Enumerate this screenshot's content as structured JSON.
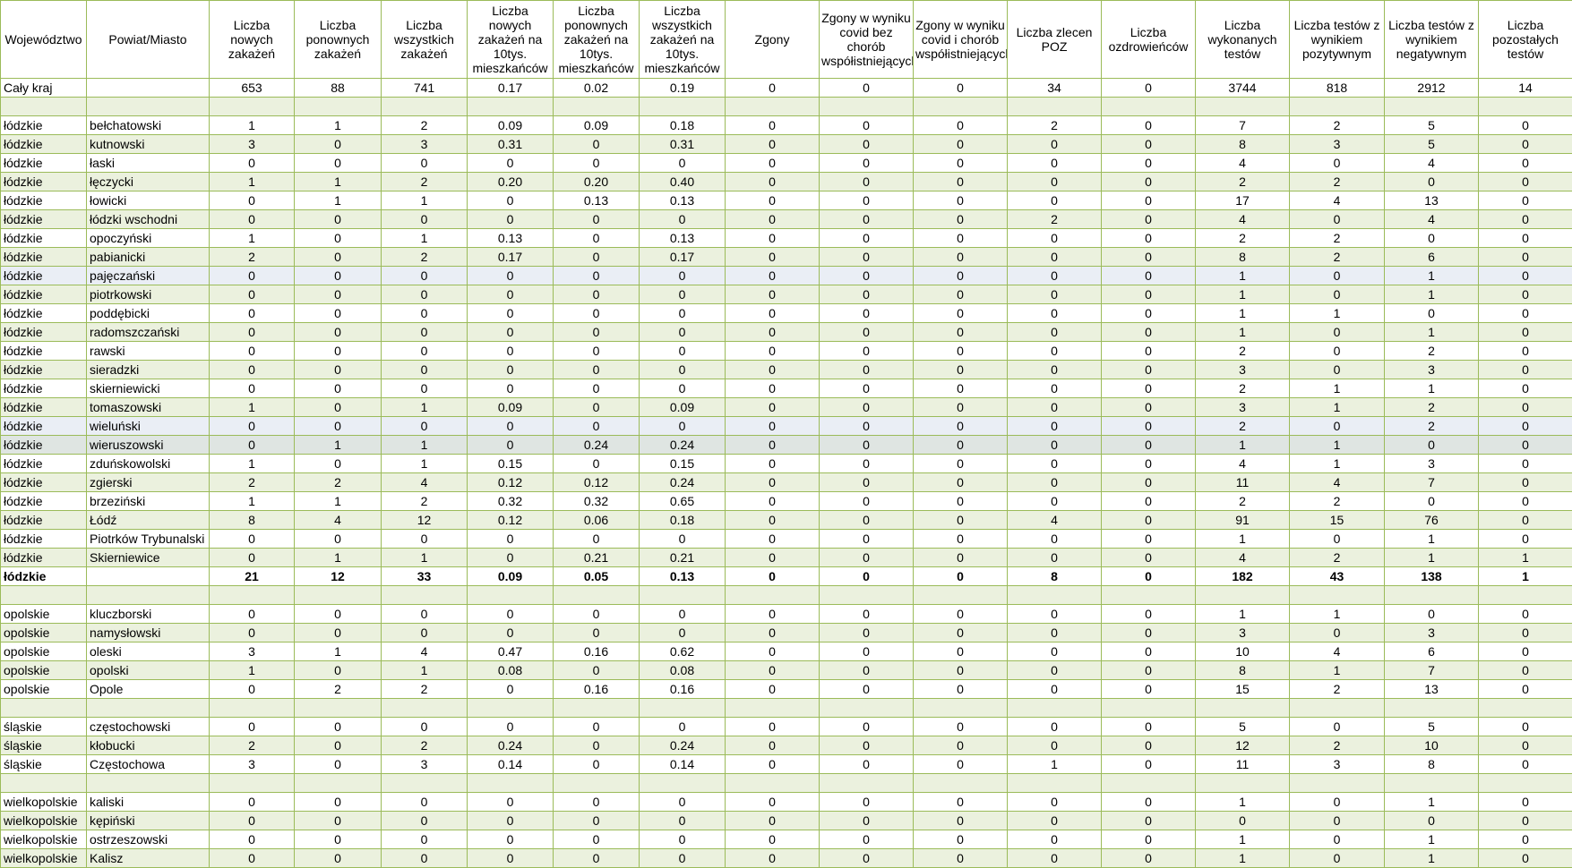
{
  "headers": [
    "Województwo",
    "Powiat/Miasto",
    "Liczba nowych zakażeń",
    "Liczba ponownych zakażeń",
    "Liczba wszystkich zakażeń",
    "Liczba nowych zakażeń na 10tys. mieszkańców",
    "Liczba ponownych zakażeń na 10tys. mieszkańców",
    "Liczba wszystkich zakażeń na 10tys. mieszkańców",
    "Zgony",
    "Zgony w wyniku covid bez chorób współistniejących",
    "Zgony w wyniku covid i chorób współistniejących",
    "Liczba zlecen POZ",
    "Liczba ozdrowieńców",
    "Liczba wykonanych testów",
    "Liczba testów z wynikiem pozytywnym",
    "Liczba testów z wynikiem negatywnym",
    "Liczba pozostałych testów"
  ],
  "rows": [
    {
      "cells": [
        "Cały kraj",
        "",
        "653",
        "88",
        "741",
        "0.17",
        "0.02",
        "0.19",
        "0",
        "0",
        "0",
        "34",
        "0",
        "3744",
        "818",
        "2912",
        "14"
      ]
    },
    {
      "cells": [
        "",
        "",
        "",
        "",
        "",
        "",
        "",
        "",
        "",
        "",
        "",
        "",
        "",
        "",
        "",
        "",
        ""
      ],
      "style": "g"
    },
    {
      "cells": [
        "łódzkie",
        "bełchatowski",
        "1",
        "1",
        "2",
        "0.09",
        "0.09",
        "0.18",
        "0",
        "0",
        "0",
        "2",
        "0",
        "7",
        "2",
        "5",
        "0"
      ]
    },
    {
      "cells": [
        "łódzkie",
        "kutnowski",
        "3",
        "0",
        "3",
        "0.31",
        "0",
        "0.31",
        "0",
        "0",
        "0",
        "0",
        "0",
        "8",
        "3",
        "5",
        "0"
      ],
      "style": "g"
    },
    {
      "cells": [
        "łódzkie",
        "łaski",
        "0",
        "0",
        "0",
        "0",
        "0",
        "0",
        "0",
        "0",
        "0",
        "0",
        "0",
        "4",
        "0",
        "4",
        "0"
      ]
    },
    {
      "cells": [
        "łódzkie",
        "łęczycki",
        "1",
        "1",
        "2",
        "0.20",
        "0.20",
        "0.40",
        "0",
        "0",
        "0",
        "0",
        "0",
        "2",
        "2",
        "0",
        "0"
      ],
      "style": "g"
    },
    {
      "cells": [
        "łódzkie",
        "łowicki",
        "0",
        "1",
        "1",
        "0",
        "0.13",
        "0.13",
        "0",
        "0",
        "0",
        "0",
        "0",
        "17",
        "4",
        "13",
        "0"
      ]
    },
    {
      "cells": [
        "łódzkie",
        "łódzki wschodni",
        "0",
        "0",
        "0",
        "0",
        "0",
        "0",
        "0",
        "0",
        "0",
        "2",
        "0",
        "4",
        "0",
        "4",
        "0"
      ],
      "style": "g"
    },
    {
      "cells": [
        "łódzkie",
        "opoczyński",
        "1",
        "0",
        "1",
        "0.13",
        "0",
        "0.13",
        "0",
        "0",
        "0",
        "0",
        "0",
        "2",
        "2",
        "0",
        "0"
      ]
    },
    {
      "cells": [
        "łódzkie",
        "pabianicki",
        "2",
        "0",
        "2",
        "0.17",
        "0",
        "0.17",
        "0",
        "0",
        "0",
        "0",
        "0",
        "8",
        "2",
        "6",
        "0"
      ],
      "style": "g"
    },
    {
      "cells": [
        "łódzkie",
        "pajęczański",
        "0",
        "0",
        "0",
        "0",
        "0",
        "0",
        "0",
        "0",
        "0",
        "0",
        "0",
        "1",
        "0",
        "1",
        "0"
      ],
      "style": "b"
    },
    {
      "cells": [
        "łódzkie",
        "piotrkowski",
        "0",
        "0",
        "0",
        "0",
        "0",
        "0",
        "0",
        "0",
        "0",
        "0",
        "0",
        "1",
        "0",
        "1",
        "0"
      ],
      "style": "g"
    },
    {
      "cells": [
        "łódzkie",
        "poddębicki",
        "0",
        "0",
        "0",
        "0",
        "0",
        "0",
        "0",
        "0",
        "0",
        "0",
        "0",
        "1",
        "1",
        "0",
        "0"
      ]
    },
    {
      "cells": [
        "łódzkie",
        "radomszczański",
        "0",
        "0",
        "0",
        "0",
        "0",
        "0",
        "0",
        "0",
        "0",
        "0",
        "0",
        "1",
        "0",
        "1",
        "0"
      ],
      "style": "g"
    },
    {
      "cells": [
        "łódzkie",
        "rawski",
        "0",
        "0",
        "0",
        "0",
        "0",
        "0",
        "0",
        "0",
        "0",
        "0",
        "0",
        "2",
        "0",
        "2",
        "0"
      ]
    },
    {
      "cells": [
        "łódzkie",
        "sieradzki",
        "0",
        "0",
        "0",
        "0",
        "0",
        "0",
        "0",
        "0",
        "0",
        "0",
        "0",
        "3",
        "0",
        "3",
        "0"
      ],
      "style": "g"
    },
    {
      "cells": [
        "łódzkie",
        "skierniewicki",
        "0",
        "0",
        "0",
        "0",
        "0",
        "0",
        "0",
        "0",
        "0",
        "0",
        "0",
        "2",
        "1",
        "1",
        "0"
      ]
    },
    {
      "cells": [
        "łódzkie",
        "tomaszowski",
        "1",
        "0",
        "1",
        "0.09",
        "0",
        "0.09",
        "0",
        "0",
        "0",
        "0",
        "0",
        "3",
        "1",
        "2",
        "0"
      ],
      "style": "g"
    },
    {
      "cells": [
        "łódzkie",
        "wieluński",
        "0",
        "0",
        "0",
        "0",
        "0",
        "0",
        "0",
        "0",
        "0",
        "0",
        "0",
        "2",
        "0",
        "2",
        "0"
      ],
      "style": "b"
    },
    {
      "cells": [
        "łódzkie",
        "wieruszowski",
        "0",
        "1",
        "1",
        "0",
        "0.24",
        "0.24",
        "0",
        "0",
        "0",
        "0",
        "0",
        "1",
        "1",
        "0",
        "0"
      ],
      "style": "s"
    },
    {
      "cells": [
        "łódzkie",
        "zduńskowolski",
        "1",
        "0",
        "1",
        "0.15",
        "0",
        "0.15",
        "0",
        "0",
        "0",
        "0",
        "0",
        "4",
        "1",
        "3",
        "0"
      ]
    },
    {
      "cells": [
        "łódzkie",
        "zgierski",
        "2",
        "2",
        "4",
        "0.12",
        "0.12",
        "0.24",
        "0",
        "0",
        "0",
        "0",
        "0",
        "11",
        "4",
        "7",
        "0"
      ],
      "style": "g"
    },
    {
      "cells": [
        "łódzkie",
        "brzeziński",
        "1",
        "1",
        "2",
        "0.32",
        "0.32",
        "0.65",
        "0",
        "0",
        "0",
        "0",
        "0",
        "2",
        "2",
        "0",
        "0"
      ]
    },
    {
      "cells": [
        "łódzkie",
        "Łódź",
        "8",
        "4",
        "12",
        "0.12",
        "0.06",
        "0.18",
        "0",
        "0",
        "0",
        "4",
        "0",
        "91",
        "15",
        "76",
        "0"
      ],
      "style": "g"
    },
    {
      "cells": [
        "łódzkie",
        "Piotrków Trybunalski",
        "0",
        "0",
        "0",
        "0",
        "0",
        "0",
        "0",
        "0",
        "0",
        "0",
        "0",
        "1",
        "0",
        "1",
        "0"
      ]
    },
    {
      "cells": [
        "łódzkie",
        "Skierniewice",
        "0",
        "1",
        "1",
        "0",
        "0.21",
        "0.21",
        "0",
        "0",
        "0",
        "0",
        "0",
        "4",
        "2",
        "1",
        "1"
      ],
      "style": "g"
    },
    {
      "cells": [
        "łódzkie",
        "",
        "21",
        "12",
        "33",
        "0.09",
        "0.05",
        "0.13",
        "0",
        "0",
        "0",
        "8",
        "0",
        "182",
        "43",
        "138",
        "1"
      ],
      "total": true
    },
    {
      "cells": [
        "",
        "",
        "",
        "",
        "",
        "",
        "",
        "",
        "",
        "",
        "",
        "",
        "",
        "",
        "",
        "",
        ""
      ],
      "style": "g"
    },
    {
      "cells": [
        "opolskie",
        "kluczborski",
        "0",
        "0",
        "0",
        "0",
        "0",
        "0",
        "0",
        "0",
        "0",
        "0",
        "0",
        "1",
        "1",
        "0",
        "0"
      ]
    },
    {
      "cells": [
        "opolskie",
        "namysłowski",
        "0",
        "0",
        "0",
        "0",
        "0",
        "0",
        "0",
        "0",
        "0",
        "0",
        "0",
        "3",
        "0",
        "3",
        "0"
      ],
      "style": "g"
    },
    {
      "cells": [
        "opolskie",
        "oleski",
        "3",
        "1",
        "4",
        "0.47",
        "0.16",
        "0.62",
        "0",
        "0",
        "0",
        "0",
        "0",
        "10",
        "4",
        "6",
        "0"
      ]
    },
    {
      "cells": [
        "opolskie",
        "opolski",
        "1",
        "0",
        "1",
        "0.08",
        "0",
        "0.08",
        "0",
        "0",
        "0",
        "0",
        "0",
        "8",
        "1",
        "7",
        "0"
      ],
      "style": "g"
    },
    {
      "cells": [
        "opolskie",
        "Opole",
        "0",
        "2",
        "2",
        "0",
        "0.16",
        "0.16",
        "0",
        "0",
        "0",
        "0",
        "0",
        "15",
        "2",
        "13",
        "0"
      ]
    },
    {
      "cells": [
        "",
        "",
        "",
        "",
        "",
        "",
        "",
        "",
        "",
        "",
        "",
        "",
        "",
        "",
        "",
        "",
        ""
      ],
      "style": "g"
    },
    {
      "cells": [
        "śląskie",
        "częstochowski",
        "0",
        "0",
        "0",
        "0",
        "0",
        "0",
        "0",
        "0",
        "0",
        "0",
        "0",
        "5",
        "0",
        "5",
        "0"
      ]
    },
    {
      "cells": [
        "śląskie",
        "kłobucki",
        "2",
        "0",
        "2",
        "0.24",
        "0",
        "0.24",
        "0",
        "0",
        "0",
        "0",
        "0",
        "12",
        "2",
        "10",
        "0"
      ],
      "style": "g"
    },
    {
      "cells": [
        "śląskie",
        "Częstochowa",
        "3",
        "0",
        "3",
        "0.14",
        "0",
        "0.14",
        "0",
        "0",
        "0",
        "1",
        "0",
        "11",
        "3",
        "8",
        "0"
      ]
    },
    {
      "cells": [
        "",
        "",
        "",
        "",
        "",
        "",
        "",
        "",
        "",
        "",
        "",
        "",
        "",
        "",
        "",
        "",
        ""
      ],
      "style": "g"
    },
    {
      "cells": [
        "wielkopolskie",
        "kaliski",
        "0",
        "0",
        "0",
        "0",
        "0",
        "0",
        "0",
        "0",
        "0",
        "0",
        "0",
        "1",
        "0",
        "1",
        "0"
      ]
    },
    {
      "cells": [
        "wielkopolskie",
        "kępiński",
        "0",
        "0",
        "0",
        "0",
        "0",
        "0",
        "0",
        "0",
        "0",
        "0",
        "0",
        "0",
        "0",
        "0",
        "0"
      ],
      "style": "g"
    },
    {
      "cells": [
        "wielkopolskie",
        "ostrzeszowski",
        "0",
        "0",
        "0",
        "0",
        "0",
        "0",
        "0",
        "0",
        "0",
        "0",
        "0",
        "1",
        "0",
        "1",
        "0"
      ]
    },
    {
      "cells": [
        "wielkopolskie",
        "Kalisz",
        "0",
        "0",
        "0",
        "0",
        "0",
        "0",
        "0",
        "0",
        "0",
        "0",
        "0",
        "1",
        "0",
        "1",
        "0"
      ],
      "style": "g"
    }
  ]
}
